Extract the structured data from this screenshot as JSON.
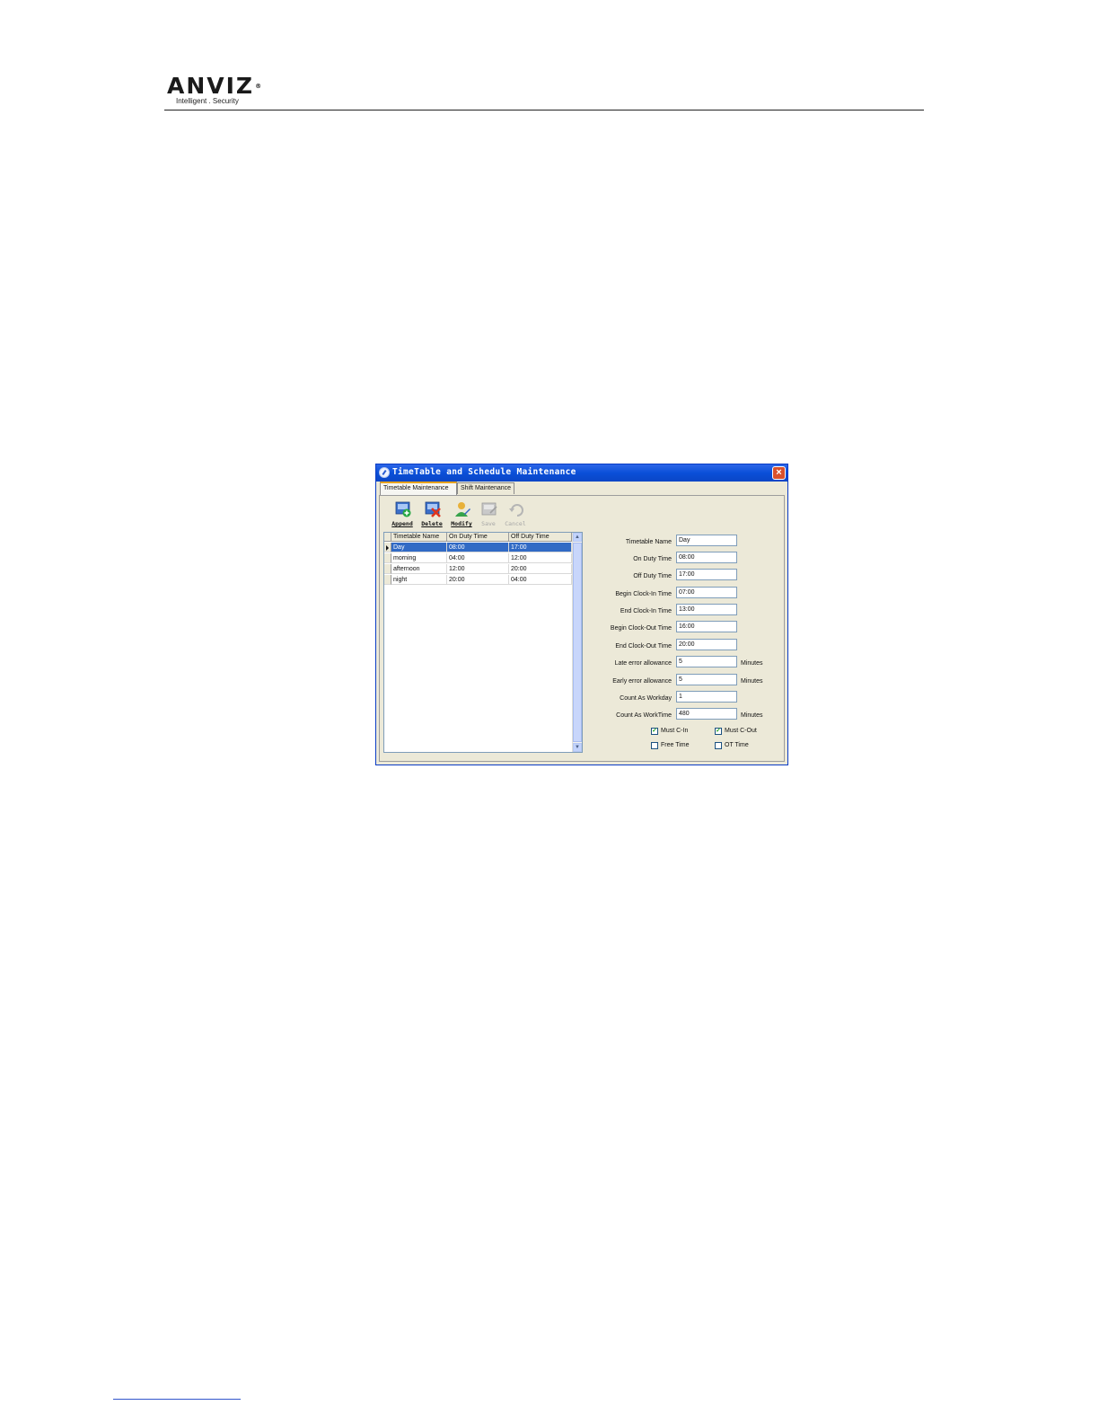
{
  "header": {
    "logo_text": "ANVIZ",
    "logo_mark": "®",
    "tagline": "Intelligent . Security"
  },
  "window": {
    "title": "TimeTable and Schedule Maintenance",
    "close_label": "×",
    "tabs": [
      {
        "label": "Timetable Maintenance",
        "active": true
      },
      {
        "label": "Shift Maintenance",
        "active": false
      }
    ]
  },
  "toolbar": {
    "append": "Append",
    "delete": "Delete",
    "modify": "Modify",
    "save": "Save",
    "cancel": "Cancel"
  },
  "grid": {
    "columns": [
      "Timetable Name",
      "On Duty Time",
      "Off Duty Time"
    ],
    "rows": [
      [
        "Day",
        "08:00",
        "17:00"
      ],
      [
        "morning",
        "04:00",
        "12:00"
      ],
      [
        "afternoon",
        "12:00",
        "20:00"
      ],
      [
        "night",
        "20:00",
        "04:00"
      ]
    ],
    "selected_row": 0
  },
  "form": {
    "fields": [
      {
        "label": "Timetable Name",
        "value": "Day",
        "unit": ""
      },
      {
        "label": "On Duty Time",
        "value": "08:00",
        "unit": ""
      },
      {
        "label": "Off Duty Time",
        "value": "17:00",
        "unit": ""
      },
      {
        "label": "Begin Clock-In Time",
        "value": "07:00",
        "unit": ""
      },
      {
        "label": "End Clock-In Time",
        "value": "13:00",
        "unit": ""
      },
      {
        "label": "Begin Clock-Out Time",
        "value": "16:00",
        "unit": ""
      },
      {
        "label": "End Clock-Out Time",
        "value": "20:00",
        "unit": ""
      },
      {
        "label": "Late error allowance",
        "value": "5",
        "unit": "Minutes"
      },
      {
        "label": "Early error allowance",
        "value": "5",
        "unit": "Minutes"
      },
      {
        "label": "Count As Workday",
        "value": "1",
        "unit": ""
      },
      {
        "label": "Count As WorkTime",
        "value": "480",
        "unit": "Minutes"
      }
    ],
    "checkboxes": [
      {
        "label": "Must C-In",
        "checked": true
      },
      {
        "label": "Must C-Out",
        "checked": true
      },
      {
        "label": "Free Time",
        "checked": false
      },
      {
        "label": "OT Time",
        "checked": false
      }
    ]
  }
}
